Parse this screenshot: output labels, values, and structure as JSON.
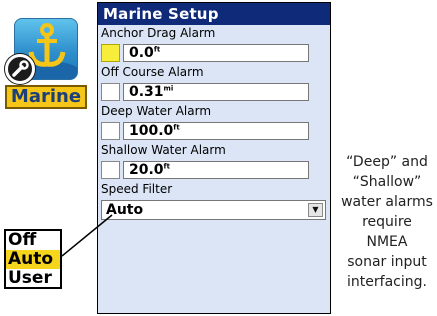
{
  "app_icon": {
    "label": "Marine"
  },
  "window": {
    "title": "Marine Setup"
  },
  "fields": [
    {
      "label": "Anchor Drag Alarm",
      "value": "0.0",
      "unit": "ft",
      "enabled": true
    },
    {
      "label": "Off Course Alarm",
      "value": "0.31",
      "unit": "mi",
      "enabled": false
    },
    {
      "label": "Deep Water Alarm",
      "value": "100.0",
      "unit": "ft",
      "enabled": false
    },
    {
      "label": "Shallow Water Alarm",
      "value": "20.0",
      "unit": "ft",
      "enabled": false
    }
  ],
  "speed_filter": {
    "label": "Speed Filter",
    "value": "Auto"
  },
  "dropdown_options": {
    "items": [
      "Off",
      "Auto",
      "User"
    ],
    "selected": "Auto"
  },
  "caption": {
    "lines": [
      "“Deep” and",
      "“Shallow”",
      "water alarms",
      "require",
      "NMEA",
      "sonar input",
      "interfacing."
    ]
  },
  "colors": {
    "title_bar": "#102a7a",
    "screen_bg": "#dbe5f6",
    "enabled_swatch": "#f7ee3c",
    "selected_option": "#f6d51d",
    "icon_label_bg": "#f5c518"
  }
}
